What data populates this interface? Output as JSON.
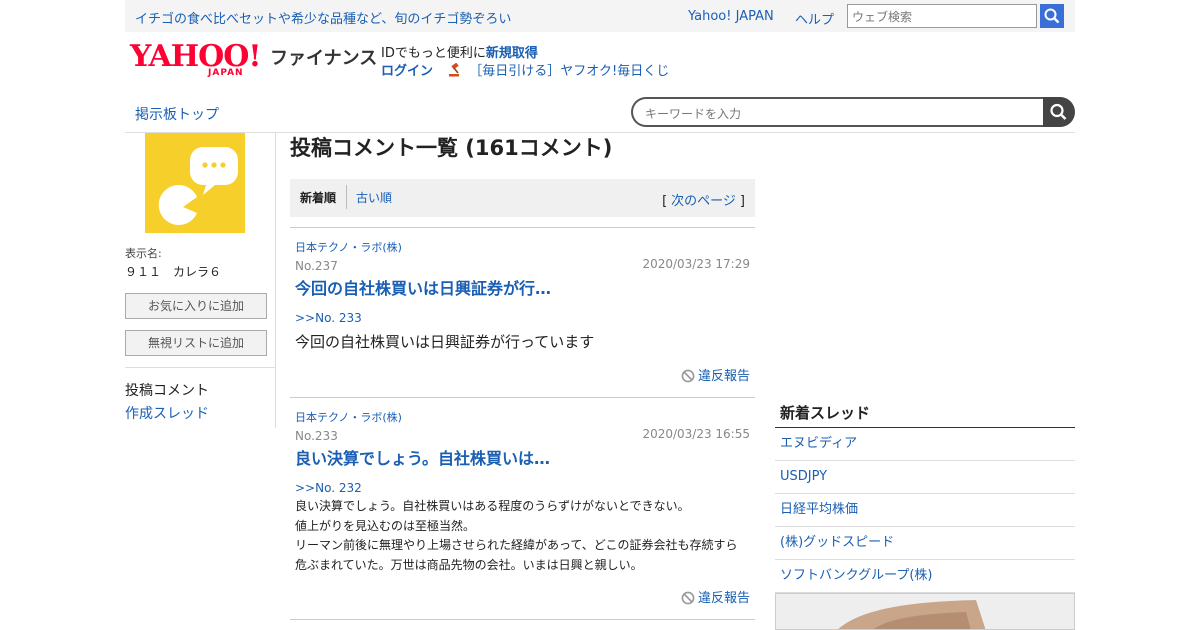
{
  "header": {
    "promo_text": "イチゴの食べ比べセットや希少な品種など、旬のイチゴ勢ぞろい",
    "yahoo_japan_link": "Yahoo! JAPAN",
    "help_link": "ヘルプ",
    "web_search_placeholder": "ウェブ検索",
    "logo_text": "YAHOO!",
    "logo_sub": "JAPAN",
    "service_name": "ファイナンス",
    "id_text": "IDでもっと便利に",
    "register_link": "新規取得",
    "login_link": "ログイン",
    "auction_link": "［毎日引ける］ヤフオク!毎日くじ"
  },
  "nav": {
    "board_top": "掲示板トップ",
    "keyword_placeholder": "キーワードを入力"
  },
  "sidebar": {
    "display_label": "表示名:",
    "display_name": "９１１　カレラ６",
    "favorite_button": "お気に入りに追加",
    "ignore_button": "無視リストに追加",
    "nav_posts": "投稿コメント",
    "nav_threads": "作成スレッド"
  },
  "main": {
    "title": "投稿コメント一覧 (161コメント)",
    "sort_new": "新着順",
    "sort_old": "古い順",
    "next_page_open": "[",
    "next_page": "次のページ",
    "next_page_close": "]",
    "comments": [
      {
        "company": "日本テクノ・ラボ(株)",
        "no": "No.237",
        "date": "2020/03/23 17:29",
        "title": "今回の自社株買いは日興証券が行…",
        "reply_to": ">>No. 233",
        "body": [
          "今回の自社株買いは日興証券が行っています"
        ],
        "report": "違反報告"
      },
      {
        "company": "日本テクノ・ラボ(株)",
        "no": "No.233",
        "date": "2020/03/23 16:55",
        "title": "良い決算でしょう。自社株買いは…",
        "reply_to": ">>No. 232",
        "body": [
          "良い決算でしょう。自社株買いはある程度のうらずけがないとできない。",
          "値上がりを見込むのは至極当然。",
          "リーマン前後に無理やり上場させられた経緯があって、どこの証券会社も存続すら",
          "危ぶまれていた。万世は商品先物の会社。いまは日興と親しい。"
        ],
        "report": "違反報告"
      }
    ]
  },
  "new_threads": {
    "heading": "新着スレッド",
    "items": [
      "エヌビディア",
      "USDJPY",
      "日経平均株価",
      "(株)グッドスピード",
      "ソフトバンクグループ(株)"
    ]
  },
  "colors": {
    "link": "#1a5fb4",
    "yahoo_red": "#ff0033",
    "avatar_yellow": "#f6cf2a"
  }
}
